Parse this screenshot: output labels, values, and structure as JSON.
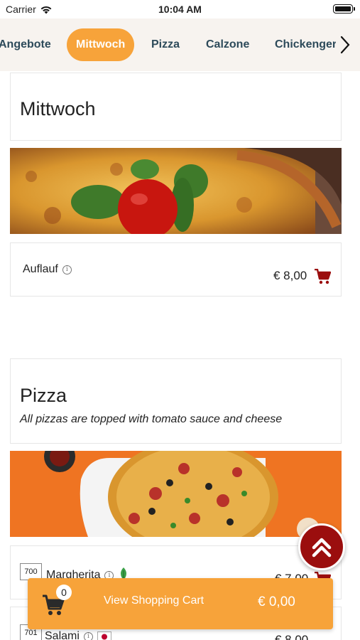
{
  "status_bar": {
    "carrier": "Carrier",
    "time": "10:04 AM"
  },
  "categories": [
    {
      "label": "Angebote",
      "active": false
    },
    {
      "label": "Mittwoch",
      "active": true
    },
    {
      "label": "Pizza",
      "active": false
    },
    {
      "label": "Calzone",
      "active": false
    },
    {
      "label": "Chickengeri",
      "active": false
    }
  ],
  "sections": [
    {
      "title": "Mittwoch",
      "description": "",
      "items": [
        {
          "number": "",
          "name": "Auflauf",
          "price": "€ 8,00"
        }
      ]
    },
    {
      "title": "Pizza",
      "description": "All pizzas are topped with tomato sauce and cheese",
      "items": [
        {
          "number": "700",
          "name": "Margherita",
          "price": "€ 7,00",
          "badge_icon": "vegetarian-leaf-icon"
        },
        {
          "number": "701",
          "name": "Salami",
          "price": "€ 8,00",
          "badge_icon": "flag-icon"
        }
      ]
    }
  ],
  "cart_bar": {
    "count": "0",
    "label": "View Shopping Cart",
    "total": "€ 0,00"
  },
  "colors": {
    "accent": "#f7a33a",
    "cart_icon": "#9b0e0e",
    "category_text": "#2d4a5a",
    "category_bg": "#f7f3ef"
  }
}
